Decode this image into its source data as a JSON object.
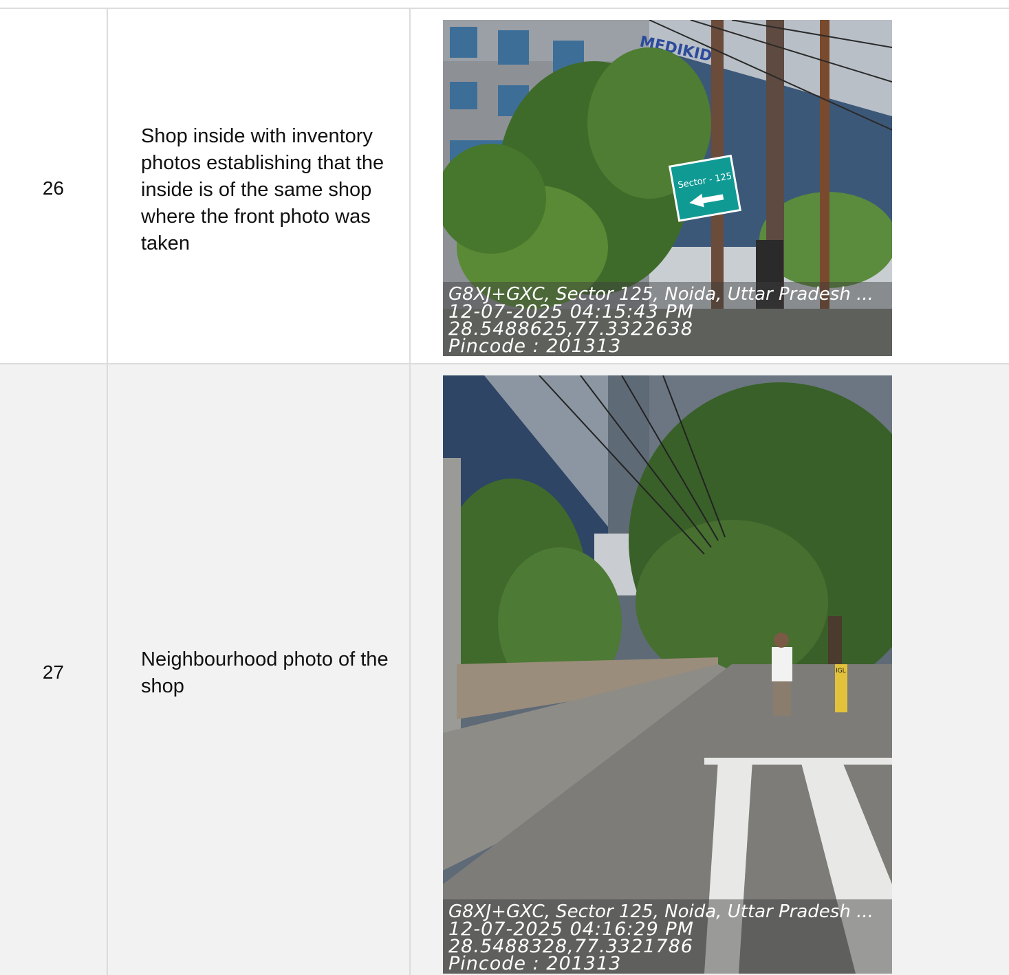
{
  "rows": [
    {
      "number": "26",
      "description": "Shop inside with inventory photos establishing that the inside is of the same shop where the front photo was taken",
      "photo": {
        "sign_text": "Sector - 125",
        "building_sign": "MEDIKIDI",
        "stamp": {
          "address": "G8XJ+GXC, Sector 125, Noida, Uttar Pradesh ...",
          "datetime": "12-07-2025 04:15:43 PM",
          "coords": "28.5488625,77.3322638",
          "pincode": "Pincode : 201313"
        }
      }
    },
    {
      "number": "27",
      "description": "Neighbourhood photo of the shop",
      "photo": {
        "post_label": "IGL",
        "stamp": {
          "address": "G8XJ+GXC, Sector 125, Noida, Uttar Pradesh ...",
          "datetime": "12-07-2025 04:16:29 PM",
          "coords": "28.5488328,77.3321786",
          "pincode": "Pincode : 201313"
        }
      }
    }
  ],
  "colors": {
    "row_alt_background": "#f2f2f2",
    "grid_line": "#dcdcdc",
    "sign_teal": "#109a94"
  }
}
